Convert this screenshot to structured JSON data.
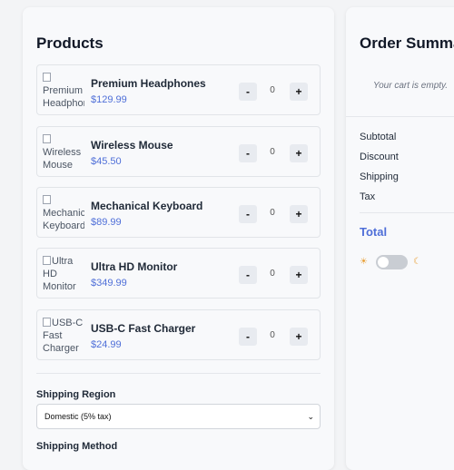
{
  "products_panel": {
    "title": "Products",
    "items": [
      {
        "name": "Premium Headphones",
        "price": "$129.99",
        "alt": "Premium Headphones",
        "qty": "0"
      },
      {
        "name": "Wireless Mouse",
        "price": "$45.50",
        "alt": "Wireless Mouse",
        "qty": "0"
      },
      {
        "name": "Mechanical Keyboard",
        "price": "$89.99",
        "alt": "Mechanical Keyboard",
        "qty": "0"
      },
      {
        "name": "Ultra HD Monitor",
        "price": "$349.99",
        "alt": "Ultra HD Monitor",
        "qty": "0"
      },
      {
        "name": "USB-C Fast Charger",
        "price": "$24.99",
        "alt": "USB-C Fast Charger",
        "qty": "0"
      }
    ],
    "minus_label": "-",
    "plus_label": "+",
    "shipping_region_label": "Shipping Region",
    "shipping_region_value": "Domestic (5% tax)",
    "shipping_method_label": "Shipping Method"
  },
  "summary_panel": {
    "title": "Order Summary",
    "empty_text": "Your cart is empty.",
    "rows": [
      "Subtotal",
      "Discount",
      "Shipping",
      "Tax"
    ],
    "total_label": "Total"
  },
  "theme_toggle": {
    "sun_icon": "sun-icon",
    "moon_icon": "moon-icon",
    "dark_mode": false
  },
  "colors": {
    "accent": "#4f6fd8",
    "toggle_off": "#c9cdd3"
  }
}
